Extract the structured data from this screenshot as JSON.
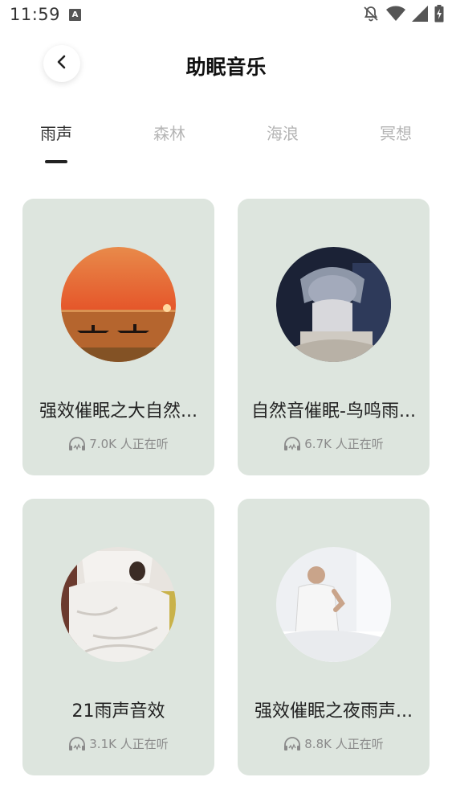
{
  "status_bar": {
    "time": "11:59",
    "input_indicator": "A",
    "icons": [
      "bell-off-icon",
      "wifi-icon",
      "signal-icon",
      "battery-charging-icon"
    ]
  },
  "header": {
    "title": "助眠音乐",
    "back_icon": "chevron-left-icon"
  },
  "tabs": [
    {
      "label": "雨声",
      "active": true
    },
    {
      "label": "森林",
      "active": false
    },
    {
      "label": "海浪",
      "active": false
    },
    {
      "label": "冥想",
      "active": false
    }
  ],
  "cards": [
    {
      "title": "强效催眠之大自然...",
      "listeners": "7.0K 人正在听",
      "cover": "sunset-lake-boats"
    },
    {
      "title": "自然音催眠-鸟鸣雨...",
      "listeners": "6.7K 人正在听",
      "cover": "man-pillow-over-head"
    },
    {
      "title": "21雨声音效",
      "listeners": "3.1K 人正在听",
      "cover": "person-sleeping-in-bed"
    },
    {
      "title": "强效催眠之夜雨声...",
      "listeners": "8.8K 人正在听",
      "cover": "man-back-pain-bed"
    }
  ],
  "colors": {
    "card_background": "#dde5de",
    "tab_active": "#333333",
    "tab_inactive": "#b5b5b5",
    "listener_text": "#8a8a8a"
  }
}
